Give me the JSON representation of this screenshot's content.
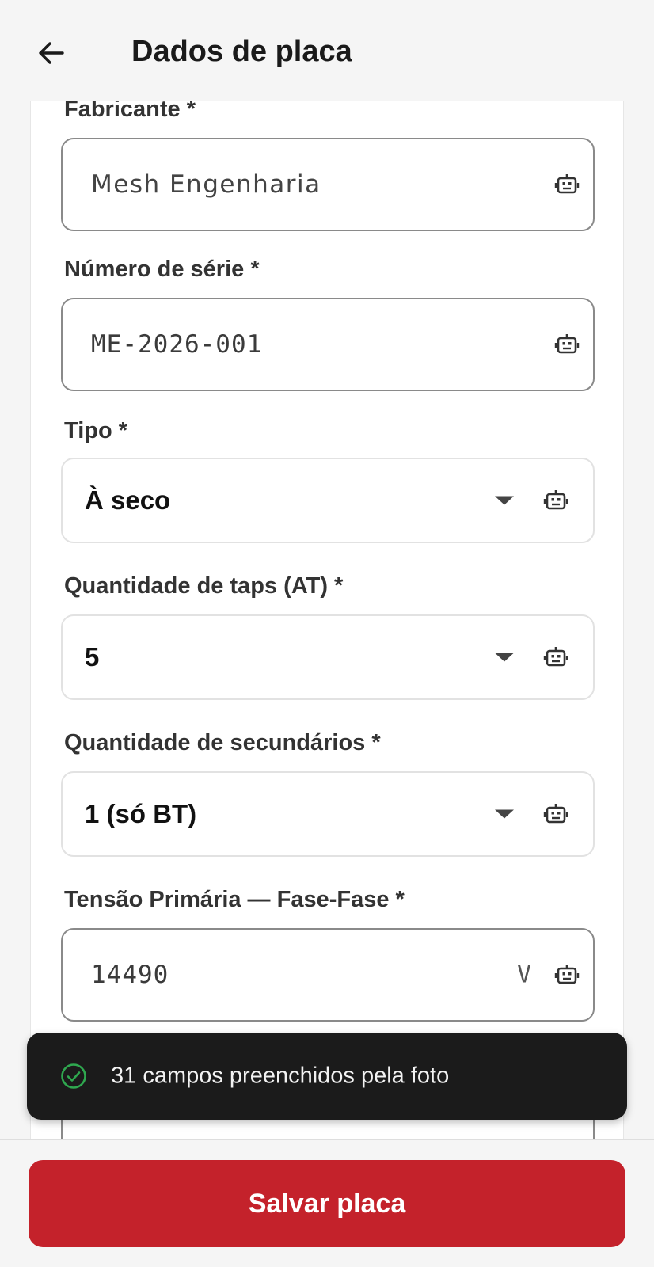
{
  "header": {
    "title": "Dados de placa",
    "back_icon": "arrow-left-icon"
  },
  "form": {
    "fabricante": {
      "label": "Fabricante *",
      "value": "Mesh Engenharia",
      "icon": "robot-icon"
    },
    "numero_serie": {
      "label": "Número de série *",
      "value": "ME-2026-001",
      "icon": "robot-icon"
    },
    "tipo": {
      "label": "Tipo *",
      "value": "À seco",
      "icon": "robot-icon"
    },
    "taps": {
      "label": "Quantidade de taps (AT) *",
      "value": "5",
      "icon": "robot-icon"
    },
    "secundarios": {
      "label": "Quantidade de secundários *",
      "value": "1 (só BT)",
      "icon": "robot-icon"
    },
    "tensao_primaria": {
      "label": "Tensão Primária — Fase-Fase *",
      "value": "14490",
      "unit": "V",
      "icon": "robot-icon"
    }
  },
  "snackbar": {
    "message": "31 campos preenchidos pela foto",
    "icon": "check-circle-icon",
    "icon_color": "#2fa84f"
  },
  "footer": {
    "save_label": "Salvar placa",
    "button_color": "#c4222b"
  }
}
